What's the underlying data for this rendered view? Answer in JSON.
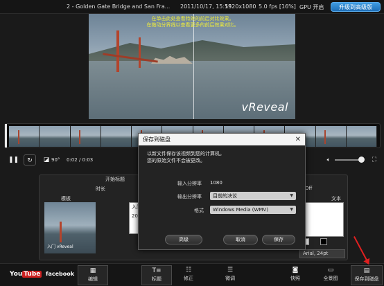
{
  "titlebar": {
    "video_title": "2 - Golden Gate Bridge and San Fra...",
    "datetime": "2011/10/17, 15:55",
    "resolution": "1920x1080",
    "fps": "5.0 fps [16%]",
    "gpu": "GPU 开启",
    "upgrade_label": "升级到高级版"
  },
  "video": {
    "hint_line1": "在单击此处查看特效的前后对比效果。",
    "hint_line2": "在拖动分界线以查看更多的前后效果对比。",
    "logo": "vReveal"
  },
  "transport": {
    "play_icon": "pause-icon",
    "rotate_label": "90°",
    "timecode": "0:02 / 0:03"
  },
  "behind_panels": {
    "title_section": "开始标题",
    "duration_label": "时长",
    "template_label": "模板",
    "off_label": "Off",
    "text_label": "文本",
    "title_text_line1": "入门",
    "title_text_line2": "201",
    "thumb_text": "入门 vReveal",
    "font_value": "Arial, 24pt"
  },
  "dialog": {
    "title": "保存到磁盘",
    "message_line1": "以新文件保存该视频到您的计算机。",
    "message_line2": "您的原始文件不会被更改。",
    "input_res_label": "输入分辨率",
    "input_res_value": "1080",
    "output_res_label": "输出分辨率",
    "output_res_value": "目前的决议",
    "format_label": "格式",
    "format_value": "Windows Media (WMV)",
    "advanced_label": "高级",
    "cancel_label": "取消",
    "save_label": "保存"
  },
  "toolbar": {
    "youtube": "You",
    "youtube_tube": "Tube",
    "facebook": "facebook",
    "edit_label": "编辑",
    "titles_label": "标题",
    "fix_label": "修正",
    "finetune_label": "微调",
    "snapshot_label": "快照",
    "panorama_label": "全景图",
    "save_to_disk_label": "保存到磁盘"
  }
}
